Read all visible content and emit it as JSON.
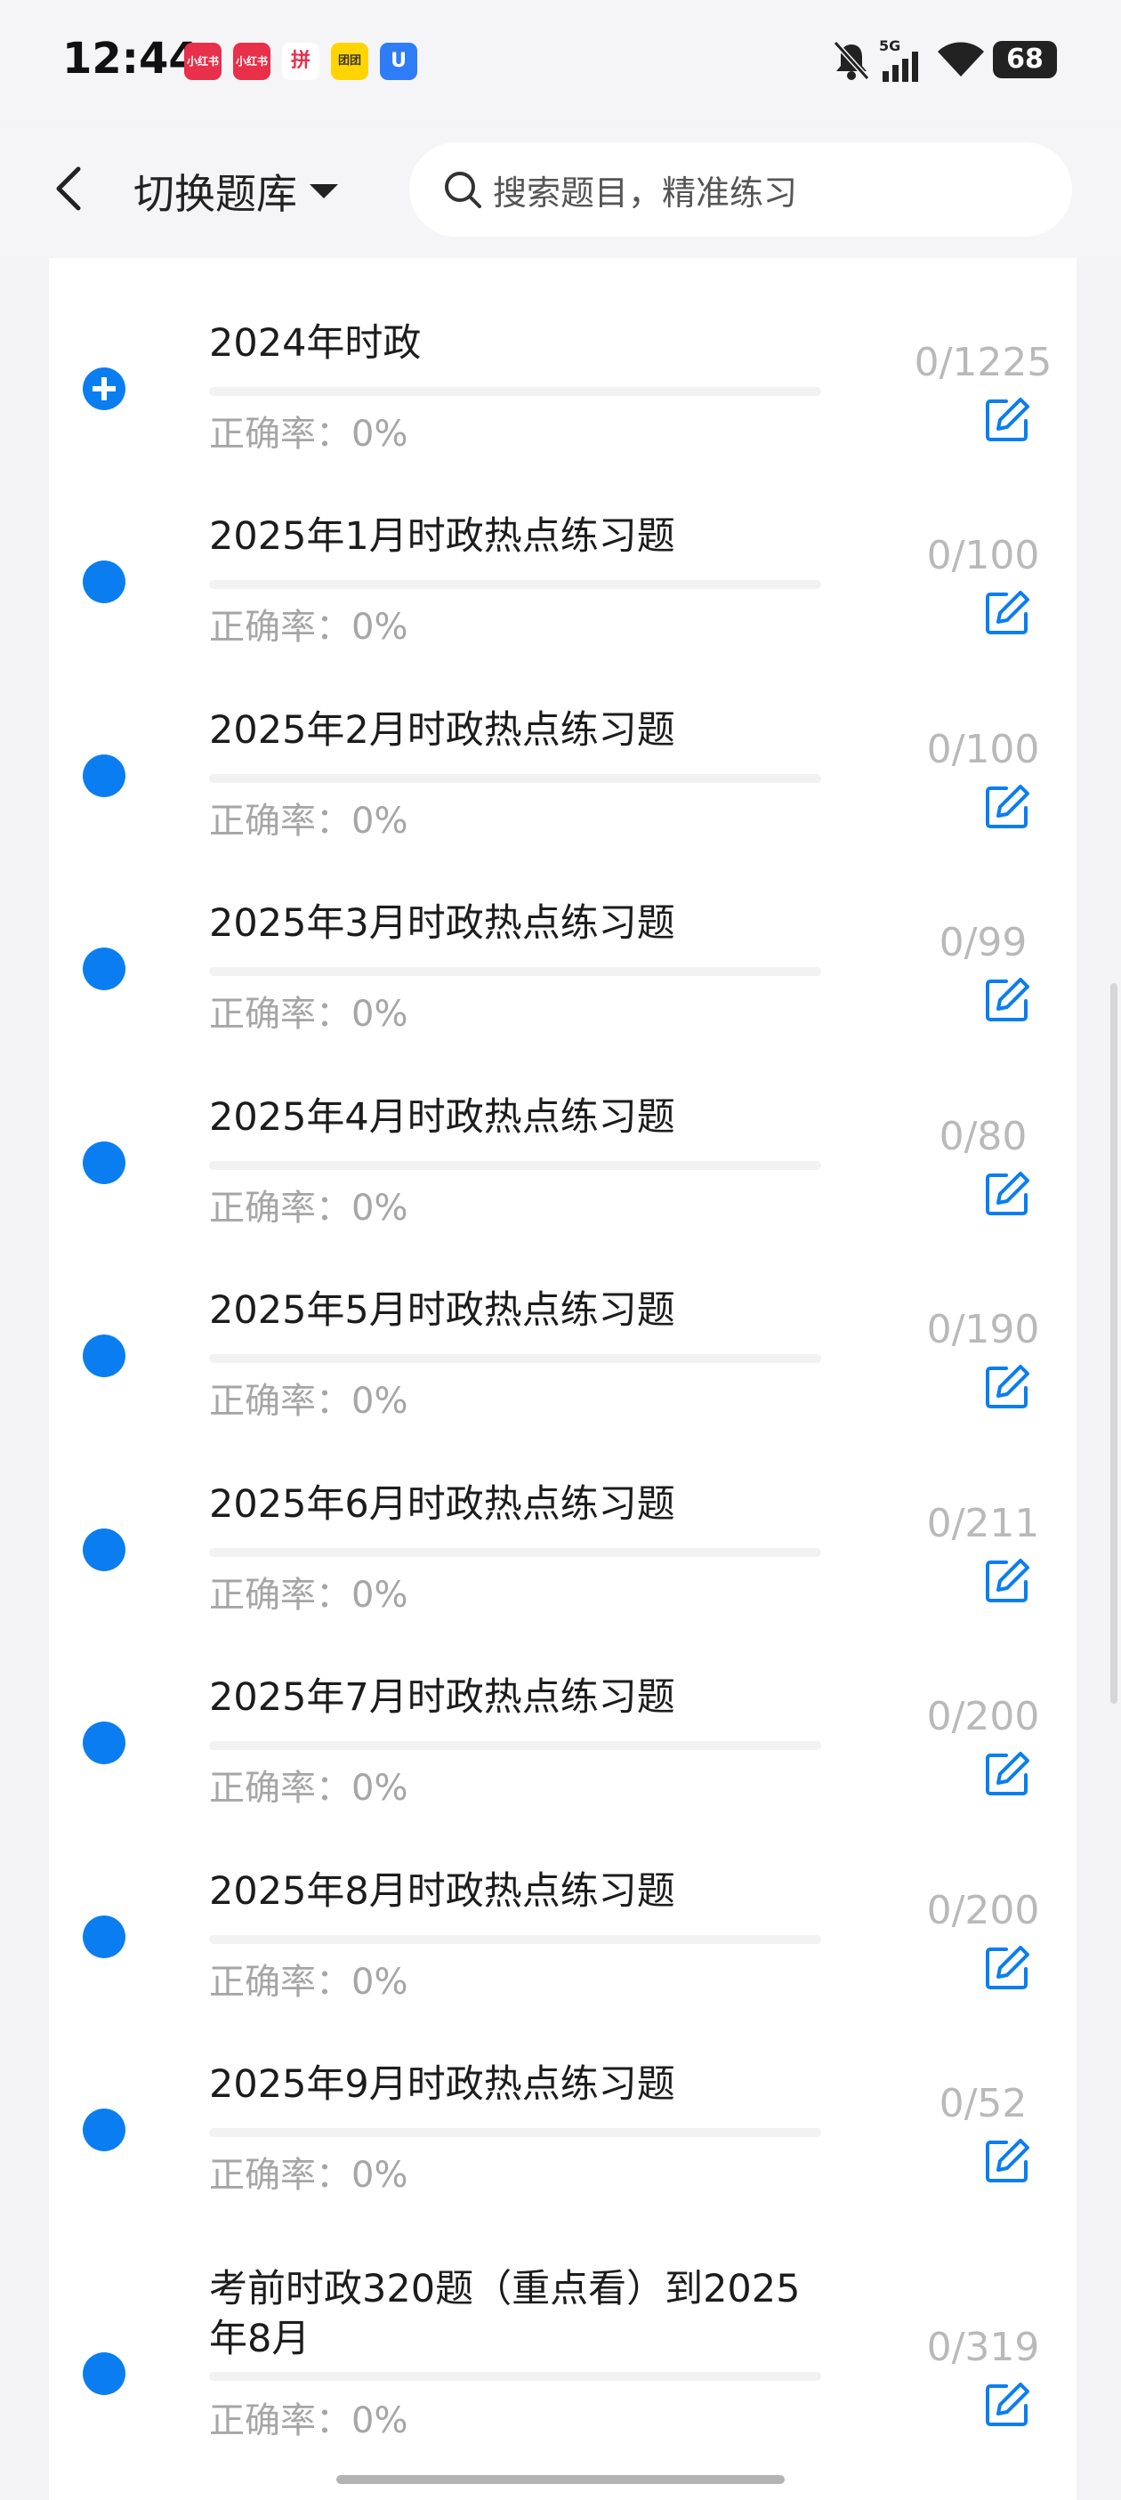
{
  "status": {
    "time": "12:44",
    "app_icons": [
      "小红书",
      "小红书",
      "拼",
      "团团",
      "U"
    ],
    "network": "5G",
    "battery": "68"
  },
  "header": {
    "title": "切换题库",
    "search_placeholder": "搜索题目，精准练习"
  },
  "rows": [
    {
      "title": "2024年时政",
      "accuracy": "正确率：0%",
      "count": "0/1225",
      "progress": 0,
      "expanded": true
    },
    {
      "title": "2025年1月时政热点练习题",
      "accuracy": "正确率：0%",
      "count": "0/100",
      "progress": 0
    },
    {
      "title": "2025年2月时政热点练习题",
      "accuracy": "正确率：0%",
      "count": "0/100",
      "progress": 0
    },
    {
      "title": "2025年3月时政热点练习题",
      "accuracy": "正确率：0%",
      "count": "0/99",
      "progress": 0
    },
    {
      "title": "2025年4月时政热点练习题",
      "accuracy": "正确率：0%",
      "count": "0/80",
      "progress": 0
    },
    {
      "title": "2025年5月时政热点练习题",
      "accuracy": "正确率：0%",
      "count": "0/190",
      "progress": 0
    },
    {
      "title": "2025年6月时政热点练习题",
      "accuracy": "正确率：0%",
      "count": "0/211",
      "progress": 0
    },
    {
      "title": "2025年7月时政热点练习题",
      "accuracy": "正确率：0%",
      "count": "0/200",
      "progress": 0
    },
    {
      "title": "2025年8月时政热点练习题",
      "accuracy": "正确率：0%",
      "count": "0/200",
      "progress": 0
    },
    {
      "title": "2025年9月时政热点练习题",
      "accuracy": "正确率：0%",
      "count": "0/52",
      "progress": 0
    },
    {
      "title": "考前时政320题（重点看）到2025年8月",
      "accuracy": "正确率：0%",
      "count": "0/319",
      "progress": 0
    }
  ],
  "colors": {
    "accent": "#0a7ef0",
    "muted": "#a6a6a6"
  }
}
